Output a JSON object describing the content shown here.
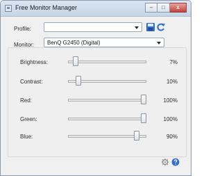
{
  "window": {
    "title": "Free Monitor Manager",
    "buttons": {
      "minimize": "–",
      "maximize": "□",
      "close": "x"
    },
    "icon": "monitor-icon"
  },
  "profile": {
    "label": "Profile:",
    "value": ""
  },
  "monitor": {
    "label": "Monitor:",
    "value": "BenQ G2450 (Digital)"
  },
  "sliders": [
    {
      "label": "Brightness:",
      "value_text": "7%",
      "value": 7
    },
    {
      "label": "Contrast:",
      "value_text": "10%",
      "value": 10
    },
    {
      "label": "Red:",
      "value_text": "100%",
      "value": 100
    },
    {
      "label": "Green:",
      "value_text": "100%",
      "value": 100
    },
    {
      "label": "Blue:",
      "value_text": "90%",
      "value": 90
    }
  ],
  "icons": {
    "save": "save-icon",
    "reset": "reset-icon",
    "settings": "gear-icon",
    "help": "help-icon"
  },
  "colors": {
    "accent_blue": "#2f6fd1",
    "close_red": "#c4413a"
  }
}
